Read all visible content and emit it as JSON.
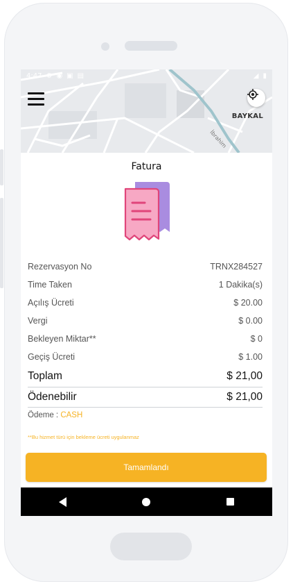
{
  "status": {
    "time": "4:47"
  },
  "map": {
    "area_label": "BAYKAL",
    "street_label": "İbrahim"
  },
  "invoice": {
    "title": "Fatura",
    "rows": [
      {
        "label": "Rezervasyon No",
        "value": "TRNX284527"
      },
      {
        "label": "Time Taken",
        "value": "1 Dakika(s)"
      },
      {
        "label": "Açılış Ücreti",
        "value": "$ 20.00"
      },
      {
        "label": "Vergi",
        "value": "$ 0.00"
      },
      {
        "label": "Bekleyen Miktar**",
        "value": "$ 0"
      },
      {
        "label": "Geçiş Ücreti",
        "value": "$ 1.00"
      }
    ],
    "total": {
      "label": "Toplam",
      "value": "$ 21,00"
    },
    "payable": {
      "label": "Ödenebilir",
      "value": "$ 21,00"
    },
    "payment_label": "Ödeme : ",
    "payment_method": "CASH",
    "note": "**Bu hizmet türü için bekleme ücreti uygulanmaz",
    "done_button": "Tamamlandı"
  },
  "colors": {
    "accent": "#f6b324",
    "receipt_front": "#f7a8c4",
    "receipt_back": "#a98ce0"
  }
}
